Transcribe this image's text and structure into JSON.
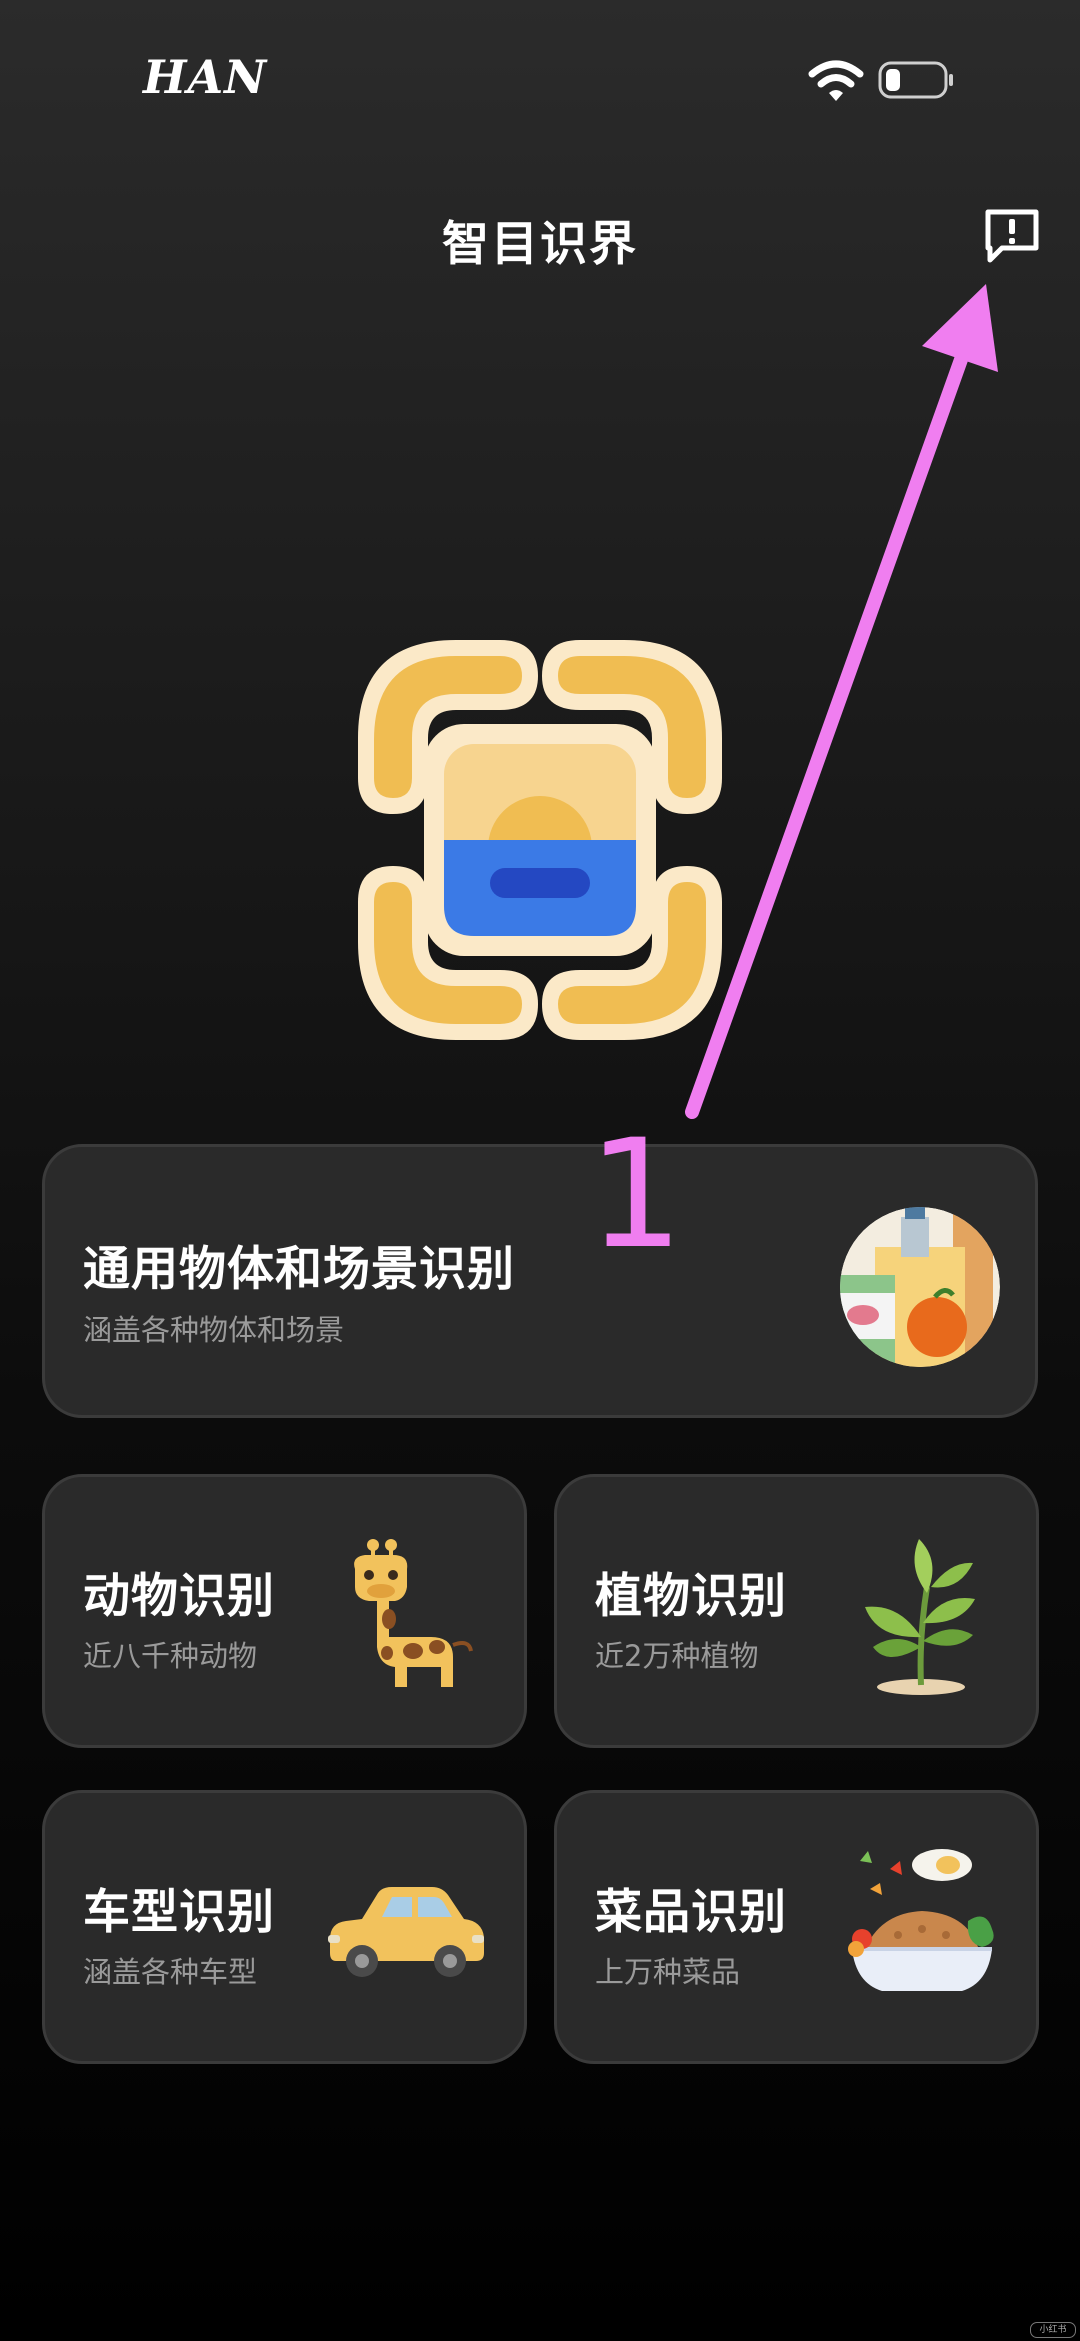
{
  "status_bar": {
    "carrier": "HAN",
    "wifi_icon": "wifi-icon",
    "battery_icon": "battery-icon",
    "battery_level_fraction": 0.15
  },
  "header": {
    "title": "智目识界",
    "feedback_icon": "feedback-icon"
  },
  "logo": {
    "icon": "recognition-logo-icon"
  },
  "categories": {
    "general": {
      "name": "通用物体和场景识别",
      "desc": "涵盖各种物体和场景",
      "icon": "groceries-icon"
    },
    "animal": {
      "name": "动物识别",
      "desc": "近八千种动物",
      "icon": "giraffe-icon"
    },
    "plant": {
      "name": "植物识别",
      "desc": "近2万种植物",
      "icon": "plant-icon"
    },
    "car": {
      "name": "车型识别",
      "desc": "涵盖各种车型",
      "icon": "car-icon"
    },
    "food": {
      "name": "菜品识别",
      "desc": "上万种菜品",
      "icon": "dish-icon"
    }
  },
  "annotation": {
    "number": "1",
    "color": "#f07ef0"
  },
  "watermark": "小红书"
}
